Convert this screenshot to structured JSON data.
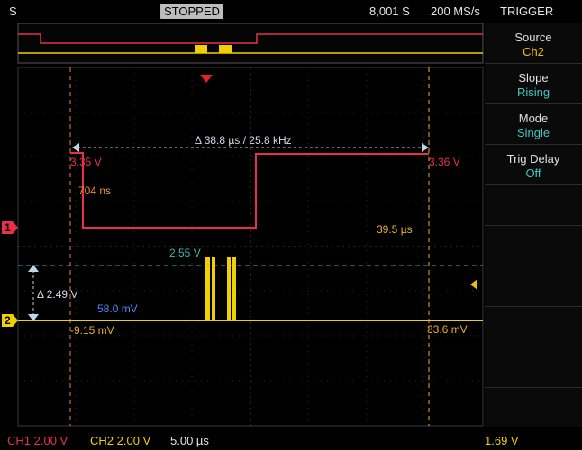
{
  "header": {
    "left_label": "S",
    "status": "STOPPED",
    "record_length": "8,001 S",
    "sample_rate": "200 MS/s",
    "mode_label": "TRIGGER"
  },
  "side_menu": [
    {
      "label": "Source",
      "value": "Ch2",
      "value_color": "#f0c000"
    },
    {
      "label": "Slope",
      "value": "Rising",
      "value_color": "#3fc8c0"
    },
    {
      "label": "Mode",
      "value": "Single",
      "value_color": "#3fc8c0"
    },
    {
      "label": "Trig Delay",
      "value": "Off",
      "value_color": "#3fc8c0"
    }
  ],
  "channel_markers": {
    "ch1": "1",
    "ch2": "2"
  },
  "measurements": {
    "delta_time": "Δ 38.8 µs / 25.8 kHz",
    "cursor1_ch1": "3.35 V",
    "cursor2_ch1": "3.36 V",
    "cursor_offset_time": "704 ns",
    "cursor_time": "39.5 µs",
    "ch2_level_high": "2.55 V",
    "ch2_delta_v": "Δ 2.49 V",
    "ch2_level_low": "58.0 mV",
    "cursor1_ch2": "-9.15 mV",
    "cursor2_ch2": "33.6 mV"
  },
  "footer": {
    "ch1_scale": "CH1 2.00 V",
    "ch2_scale": "CH2 2.00 V",
    "timebase": "5.00 µs",
    "trigger_level": "1.69 V"
  },
  "colors": {
    "ch1": "#e8304a",
    "ch2": "#f0d000",
    "cursor": "#f08030",
    "level_cyan": "#38b8b0",
    "level_blue": "#4a8cff",
    "label_orange": "#f08c3a"
  },
  "icons": {
    "trigger_pos": "triangle-down-icon",
    "trigger_level": "triangle-left-icon"
  }
}
